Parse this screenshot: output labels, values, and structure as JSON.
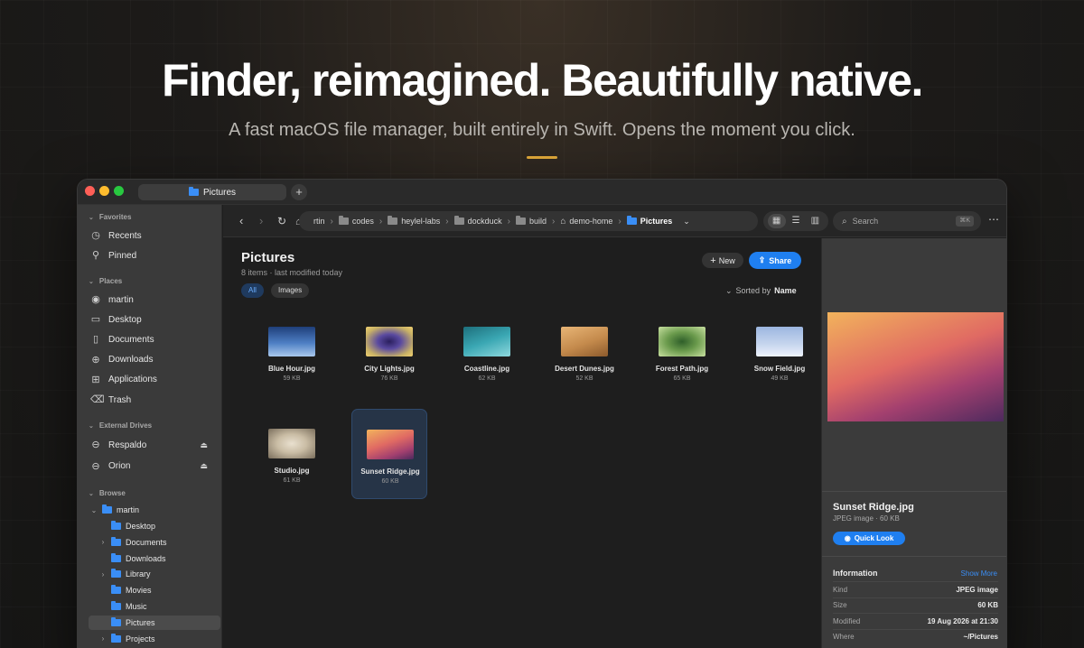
{
  "hero": {
    "title": "Finder, reimagined. Beautifully native.",
    "subtitle": "A fast macOS file manager, built entirely in Swift. Opens the moment you click."
  },
  "window": {
    "tab_title": "Pictures",
    "new_tab": "+"
  },
  "sidebar": {
    "favorites_label": "Favorites",
    "favorites": [
      {
        "label": "Recents",
        "icon": "clock-icon"
      },
      {
        "label": "Pinned",
        "icon": "pin-icon"
      }
    ],
    "places_label": "Places",
    "places": [
      {
        "label": "martin",
        "icon": "user-icon"
      },
      {
        "label": "Desktop",
        "icon": "desktop-icon"
      },
      {
        "label": "Documents",
        "icon": "document-icon"
      },
      {
        "label": "Downloads",
        "icon": "download-icon"
      },
      {
        "label": "Applications",
        "icon": "applications-icon"
      },
      {
        "label": "Trash",
        "icon": "trash-icon"
      }
    ],
    "drives_label": "External Drives",
    "drives": [
      {
        "label": "Respaldo",
        "icon": "drive-icon"
      },
      {
        "label": "Orion",
        "icon": "drive-icon"
      }
    ],
    "browse_label": "Browse",
    "tree_root": "martin",
    "tree": [
      {
        "label": "Desktop",
        "expandable": false
      },
      {
        "label": "Documents",
        "expandable": true
      },
      {
        "label": "Downloads",
        "expandable": false
      },
      {
        "label": "Library",
        "expandable": true
      },
      {
        "label": "Movies",
        "expandable": false
      },
      {
        "label": "Music",
        "expandable": false
      },
      {
        "label": "Pictures",
        "expandable": false,
        "selected": true
      },
      {
        "label": "Projects",
        "expandable": true
      }
    ]
  },
  "toolbar": {
    "crumbs": [
      "rtin",
      "codes",
      "heylel-labs",
      "dockduck",
      "build",
      "demo-home",
      "Pictures"
    ],
    "search_placeholder": "Search",
    "search_shortcut": "⌘K"
  },
  "main": {
    "title": "Pictures",
    "meta": "8 items · last modified today",
    "new_label": "New",
    "share_label": "Share",
    "filter_all": "All",
    "filter_images": "Images",
    "sort_prefix": "Sorted by",
    "sort_field": "Name",
    "files": [
      {
        "name": "Blue Hour.jpg",
        "size": "59 KB",
        "gradient": "linear-gradient(180deg,#1f3f7a 0%,#4e7fc4 55%,#a9c8ec 100%)"
      },
      {
        "name": "City Lights.jpg",
        "size": "76 KB",
        "gradient": "radial-gradient(ellipse at center,#2a1f5e 0%,#5a4aa0 35%,#c9b266 75%,#f0d070 100%)"
      },
      {
        "name": "Coastline.jpg",
        "size": "62 KB",
        "gradient": "linear-gradient(160deg,#1d6f7c 0%,#3aa7b3 50%,#8fd9de 100%)"
      },
      {
        "name": "Desert Dunes.jpg",
        "size": "52 KB",
        "gradient": "linear-gradient(160deg,#e8b576 0%,#c48a4c 55%,#8c5a2c 100%)"
      },
      {
        "name": "Forest Path.jpg",
        "size": "65 KB",
        "gradient": "radial-gradient(ellipse at center,#2f5f2a 0%,#6a9a4c 45%,#c8e0a0 100%)"
      },
      {
        "name": "Snow Field.jpg",
        "size": "49 KB",
        "gradient": "linear-gradient(180deg,#9cb6e0 0%,#c7d6ee 60%,#eef3fb 100%)"
      },
      {
        "name": "Studio.jpg",
        "size": "61 KB",
        "gradient": "radial-gradient(ellipse at center,#e9e0cf 0%,#c9bca4 45%,#7a6e5c 100%)"
      },
      {
        "name": "Sunset Ridge.jpg",
        "size": "60 KB",
        "gradient": "linear-gradient(160deg,#f2b35c 0%,#e06a63 45%,#a3406f 75%,#4d2a5e 100%)",
        "selected": true
      }
    ]
  },
  "preview": {
    "name": "Sunset Ridge.jpg",
    "meta": "JPEG image · 60 KB",
    "quick_look": "Quick Look",
    "info_label": "Information",
    "show_more": "Show More",
    "rows": [
      {
        "key": "Kind",
        "value": "JPEG image"
      },
      {
        "key": "Size",
        "value": "60 KB"
      },
      {
        "key": "Modified",
        "value": "19 Aug 2026 at 21:30"
      },
      {
        "key": "Where",
        "value": "~/Pictures"
      }
    ]
  },
  "colors": {
    "accent": "#1f7ff0",
    "folder": "#3a8ef6",
    "hero_rule": "#e0a93a"
  }
}
